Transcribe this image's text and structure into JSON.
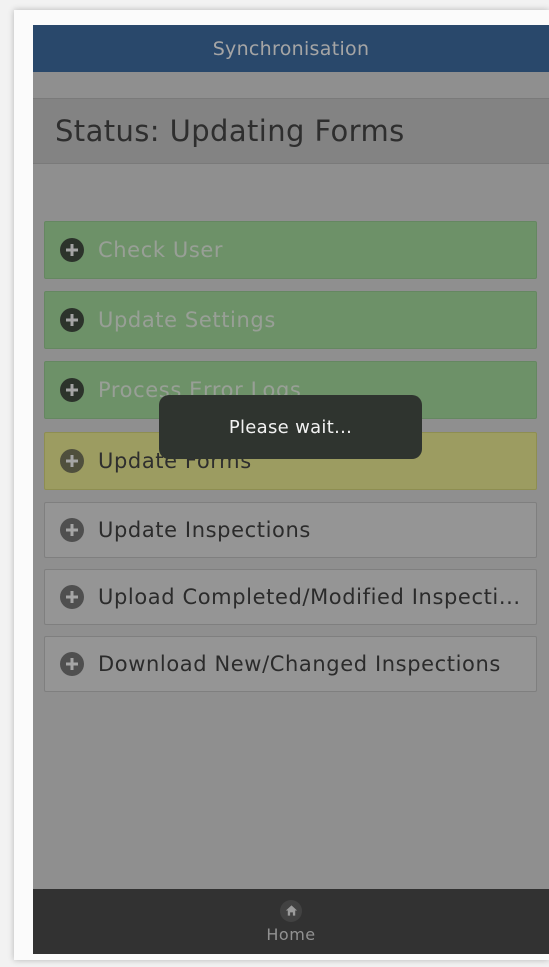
{
  "header": {
    "title": "Synchronisation"
  },
  "status": {
    "text": "Status: Updating Forms"
  },
  "steps": [
    {
      "label": "Check User",
      "state": "done",
      "icon": "plus-circle-icon"
    },
    {
      "label": "Update Settings",
      "state": "done",
      "icon": "plus-circle-icon"
    },
    {
      "label": "Process Error Logs",
      "state": "done",
      "icon": "plus-circle-icon"
    },
    {
      "label": "Update Forms",
      "state": "in-progress",
      "icon": "plus-circle-icon"
    },
    {
      "label": "Update Inspections",
      "state": "pending",
      "icon": "plus-circle-icon"
    },
    {
      "label": "Upload Completed/Modified Inspecti...",
      "state": "pending",
      "icon": "plus-circle-icon"
    },
    {
      "label": "Download New/Changed Inspections",
      "state": "pending",
      "icon": "plus-circle-icon"
    }
  ],
  "footer": {
    "home_label": "Home",
    "home_icon": "home-icon"
  },
  "toast": {
    "text": "Please wait..."
  },
  "colors": {
    "header": "#2a5f9b",
    "done": "#9fdc97",
    "in_progress": "#f0f08a",
    "pending": "#e4e4e4",
    "footer": "#3a3a3a"
  }
}
